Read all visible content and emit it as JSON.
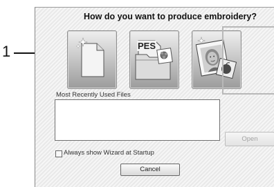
{
  "callout": {
    "number": "1"
  },
  "dialog": {
    "title": "How do you want to produce embroidery?",
    "buttons": [
      {
        "icon": "new-file-icon"
      },
      {
        "icon": "pes-folder-icon",
        "label": "PES"
      },
      {
        "icon": "photo-stitch-icon"
      }
    ],
    "mru_label": "Most Recently Used Files",
    "mru_files": [],
    "open_label": "Open",
    "checkbox_label": "Always show Wizard at Startup",
    "checkbox_checked": false,
    "cancel_label": "Cancel"
  }
}
